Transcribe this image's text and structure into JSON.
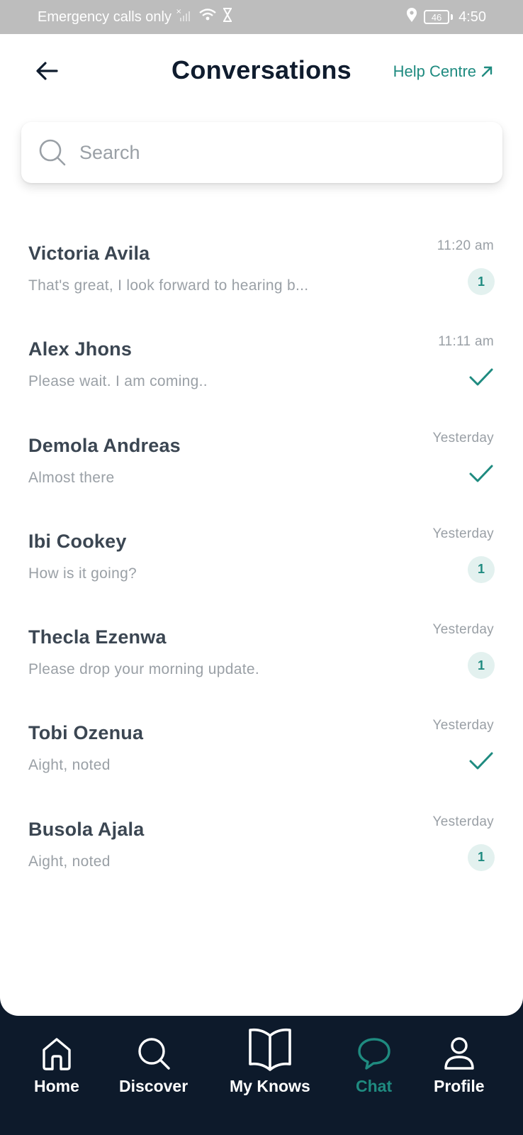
{
  "status_bar": {
    "carrier_text": "Emergency calls only",
    "battery": "46",
    "time": "4:50"
  },
  "header": {
    "title": "Conversations",
    "help_label": "Help Centre",
    "back_icon": "arrow-left-icon",
    "help_icon": "arrow-up-right-icon"
  },
  "search": {
    "placeholder": "Search",
    "value": ""
  },
  "colors": {
    "accent": "#1f8b80",
    "badge_bg": "#e3f1ef",
    "nav_bg": "#0d1a2b"
  },
  "conversations": [
    {
      "name": "Victoria Avila",
      "preview": "That's great, I look forward to hearing b...",
      "time": "11:20 am",
      "status": "unread",
      "unread_count": "1"
    },
    {
      "name": "Alex Jhons",
      "preview": "Please wait. I am coming..",
      "time": "11:11 am",
      "status": "read",
      "unread_count": ""
    },
    {
      "name": "Demola Andreas",
      "preview": "Almost there",
      "time": "Yesterday",
      "status": "read",
      "unread_count": ""
    },
    {
      "name": "Ibi Cookey",
      "preview": "How is it going?",
      "time": "Yesterday",
      "status": "unread",
      "unread_count": "1"
    },
    {
      "name": "Thecla Ezenwa",
      "preview": "Please drop your morning update.",
      "time": "Yesterday",
      "status": "unread",
      "unread_count": "1"
    },
    {
      "name": "Tobi Ozenua",
      "preview": "Aight, noted",
      "time": "Yesterday",
      "status": "read",
      "unread_count": ""
    },
    {
      "name": "Busola Ajala",
      "preview": "Aight, noted",
      "time": "Yesterday",
      "status": "unread",
      "unread_count": "1"
    }
  ],
  "bottom_nav": [
    {
      "label": "Home",
      "icon": "home-icon",
      "active": false
    },
    {
      "label": "Discover",
      "icon": "search-icon",
      "active": false
    },
    {
      "label": "My Knows",
      "icon": "book-open-icon",
      "active": false
    },
    {
      "label": "Chat",
      "icon": "chat-bubble-icon",
      "active": true
    },
    {
      "label": "Profile",
      "icon": "user-icon",
      "active": false
    }
  ]
}
